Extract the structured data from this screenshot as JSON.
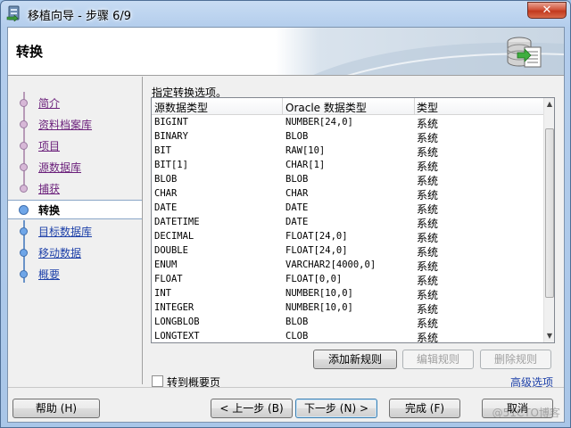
{
  "window": {
    "title": "移植向导 - 步骤 6/9",
    "close_label": "✕"
  },
  "header": {
    "title": "转换"
  },
  "nav": {
    "items": [
      {
        "label": "简介",
        "state": "visited"
      },
      {
        "label": "资料档案库",
        "state": "visited"
      },
      {
        "label": "项目",
        "state": "visited"
      },
      {
        "label": "源数据库",
        "state": "visited"
      },
      {
        "label": "捕获",
        "state": "visited"
      },
      {
        "label": "转换",
        "state": "current"
      },
      {
        "label": "目标数据库",
        "state": "pending"
      },
      {
        "label": "移动数据",
        "state": "pending"
      },
      {
        "label": "概要",
        "state": "pending"
      }
    ]
  },
  "main": {
    "instruction": "指定转换选项。",
    "columns": [
      "源数据类型",
      "Oracle 数据类型",
      "类型"
    ],
    "rows": [
      [
        "BIGINT",
        "NUMBER[24,0]",
        "系统"
      ],
      [
        "BINARY",
        "BLOB",
        "系统"
      ],
      [
        "BIT",
        "RAW[10]",
        "系统"
      ],
      [
        "BIT[1]",
        "CHAR[1]",
        "系统"
      ],
      [
        "BLOB",
        "BLOB",
        "系统"
      ],
      [
        "CHAR",
        "CHAR",
        "系统"
      ],
      [
        "DATE",
        "DATE",
        "系统"
      ],
      [
        "DATETIME",
        "DATE",
        "系统"
      ],
      [
        "DECIMAL",
        "FLOAT[24,0]",
        "系统"
      ],
      [
        "DOUBLE",
        "FLOAT[24,0]",
        "系统"
      ],
      [
        "ENUM",
        "VARCHAR2[4000,0]",
        "系统"
      ],
      [
        "FLOAT",
        "FLOAT[0,0]",
        "系统"
      ],
      [
        "INT",
        "NUMBER[10,0]",
        "系统"
      ],
      [
        "INTEGER",
        "NUMBER[10,0]",
        "系统"
      ],
      [
        "LONGBLOB",
        "BLOB",
        "系统"
      ],
      [
        "LONGTEXT",
        "CLOB",
        "系统"
      ]
    ],
    "add_rule": "添加新规则",
    "edit_rule": "编辑规则",
    "delete_rule": "删除规则",
    "goto_summary": "转到概要页",
    "advanced": "高级选项"
  },
  "footer": {
    "help": "帮助 (H)",
    "back": "< 上一步 (B)",
    "next": "下一步 (N) >",
    "finish": "完成 (F)",
    "cancel": "取消"
  },
  "watermark": "@51CTO博客"
}
